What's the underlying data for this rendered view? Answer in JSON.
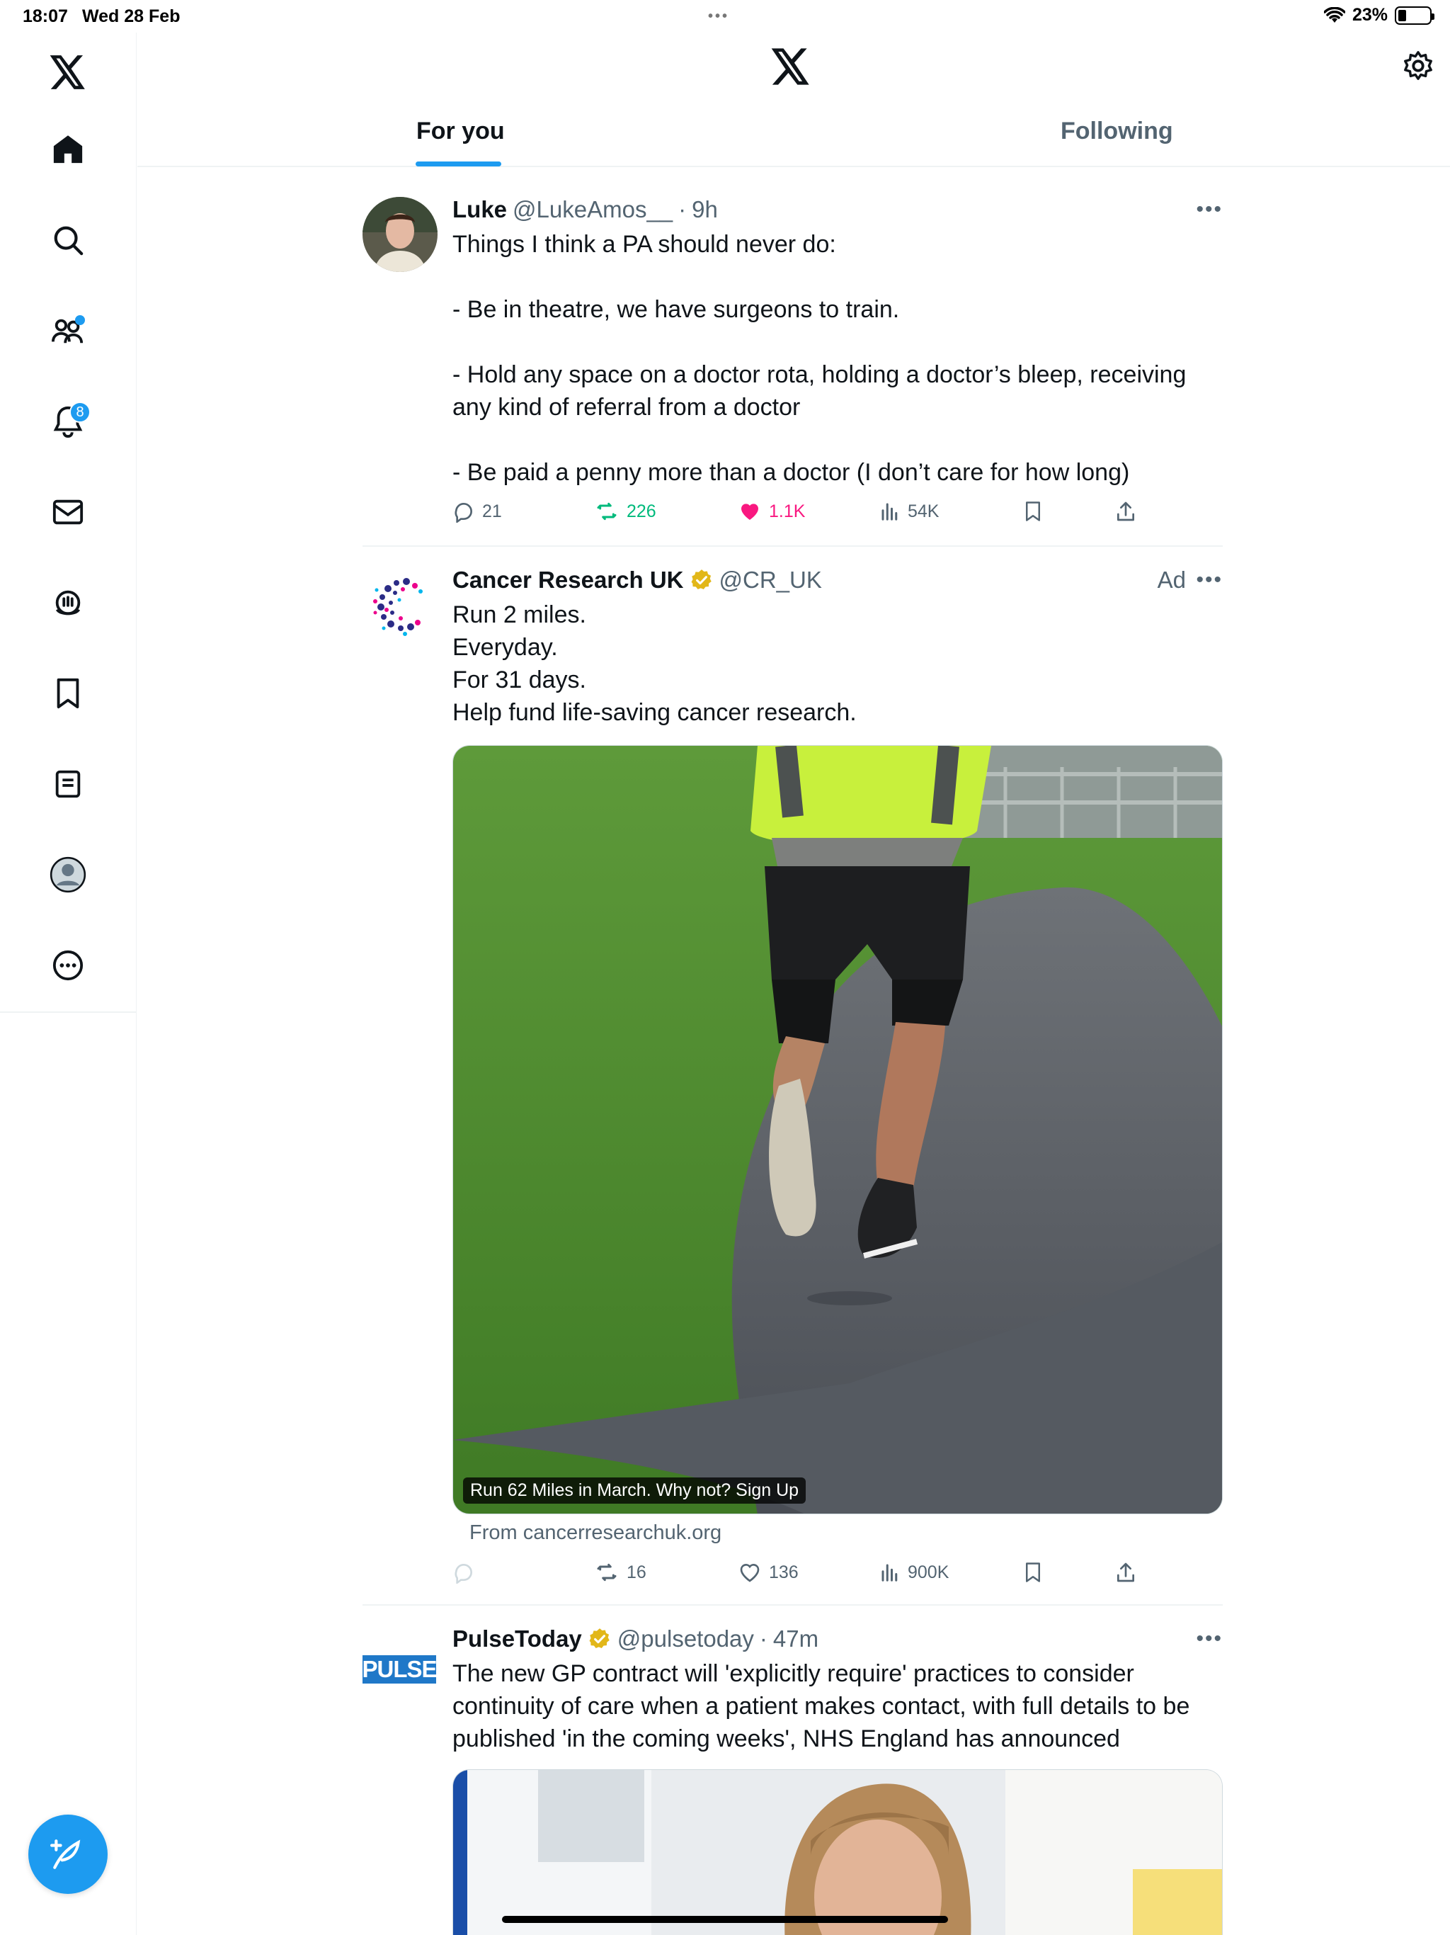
{
  "status_bar": {
    "time": "18:07",
    "date": "Wed 28 Feb",
    "battery": "23%"
  },
  "header": {
    "tabs": [
      {
        "label": "For you"
      },
      {
        "label": "Following"
      }
    ]
  },
  "sidebar": {
    "notifications_badge": "8"
  },
  "tweets": [
    {
      "name": "Luke",
      "handle": "@LukeAmos__",
      "sep": "·",
      "time": "9h",
      "text": "Things I think a PA should never do:\n\n- Be in theatre, we have surgeons to train.\n\n- Hold any space on a doctor rota, holding a doctor’s bleep, receiving any kind of referral from a doctor\n\n- Be paid a penny more than a doctor (I don’t care for how long)",
      "replies": "21",
      "retweets": "226",
      "likes": "1.1K",
      "views": "54K"
    },
    {
      "name": "Cancer Research UK",
      "handle": "@CR_UK",
      "ad_label": "Ad",
      "text": "Run 2 miles.\nEveryday.\nFor 31 days.\nHelp fund life-saving cancer research.",
      "media_caption": "Run 62 Miles in March. Why not? Sign Up",
      "source": "From cancerresearchuk.org",
      "retweets": "16",
      "likes": "136",
      "views": "900K"
    },
    {
      "name": "PulseToday",
      "handle": "@pulsetoday",
      "sep": "·",
      "time": "47m",
      "avatar_text": "PULSE",
      "text": "The new GP contract will 'explicitly require' practices to consider continuity of care when a patient makes contact, with full details to be published 'in the coming weeks', NHS England has announced"
    }
  ],
  "colors": {
    "accent": "#1d9bf0",
    "retweet": "#00ba7c",
    "like": "#f91880",
    "verified": "#e2b719"
  }
}
